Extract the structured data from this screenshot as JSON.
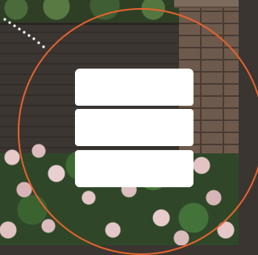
{
  "overlay": {
    "accent_color": "#e2632e",
    "fields": [
      {
        "value": ""
      },
      {
        "value": ""
      },
      {
        "value": ""
      }
    ]
  }
}
